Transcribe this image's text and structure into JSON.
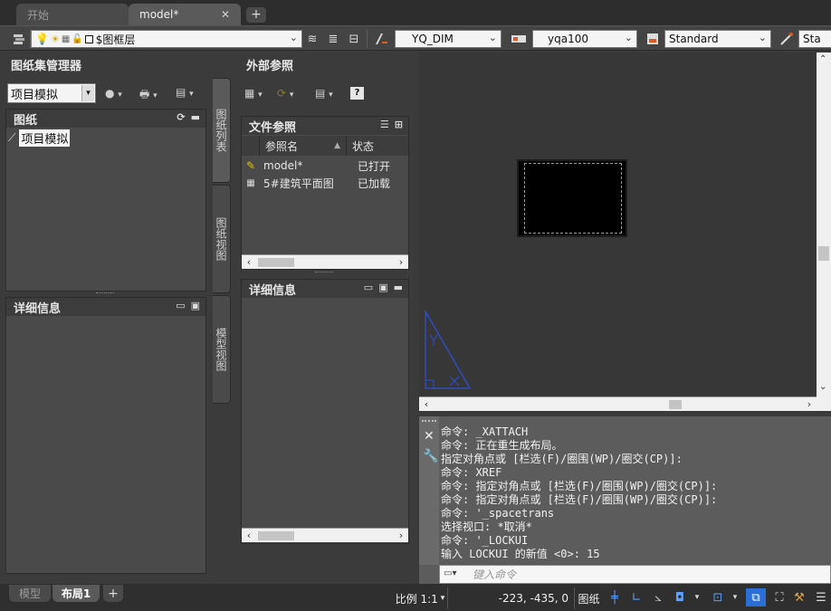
{
  "tabs": {
    "start_label": "开始",
    "model_label": "model*",
    "close_glyph": "✕",
    "plus_glyph": "+"
  },
  "toolbar": {
    "layer_value": "$图框层",
    "dimstyle_value": "YQ_DIM",
    "textstyle_value": "yqa100",
    "tablestyle_value": "Standard",
    "mleaderstyle_value": "Sta"
  },
  "sheetset": {
    "title": "图纸集管理器",
    "project_select": "项目模拟",
    "sheets_header": "图纸",
    "sheet_item": "项目模拟",
    "details_header": "详细信息",
    "vtab_sheetlist": "图纸列表",
    "vtab_sheetviews": "图纸视图",
    "vtab_modelviews": "模型视图"
  },
  "xref": {
    "title": "外部参照",
    "file_refs_header": "文件参照",
    "col_name": "参照名",
    "col_status": "状态",
    "rows": [
      {
        "name": "model*",
        "status": "已打开",
        "icon": "drawing-icon"
      },
      {
        "name": "5#建筑平面图",
        "status": "已加载",
        "icon": "dwg-icon"
      }
    ],
    "details_header": "详细信息"
  },
  "command": {
    "history": [
      "命令: _XATTACH",
      "命令: 正在重生成布局。",
      "指定对角点或 [栏选(F)/圈围(WP)/圈交(CP)]:",
      "命令: XREF",
      "命令: 指定对角点或 [栏选(F)/圈围(WP)/圈交(CP)]:",
      "命令: 指定对角点或 [栏选(F)/圈围(WP)/圈交(CP)]:",
      "命令: '_spacetrans",
      "选择视口: *取消*",
      "命令: '_LOCKUI",
      "输入 LOCKUI 的新值 <0>: 15"
    ],
    "placeholder": "键入命令"
  },
  "status": {
    "model_tab": "模型",
    "layout_tab": "布局1",
    "add_glyph": "+",
    "scale": "比例 1:1",
    "coords": "-223, -435, 0",
    "paper": "图纸"
  },
  "colors": {
    "ucs_icon": "#2d4fd0",
    "viewport_fill": "#000000",
    "background": "#3b3b3b"
  }
}
